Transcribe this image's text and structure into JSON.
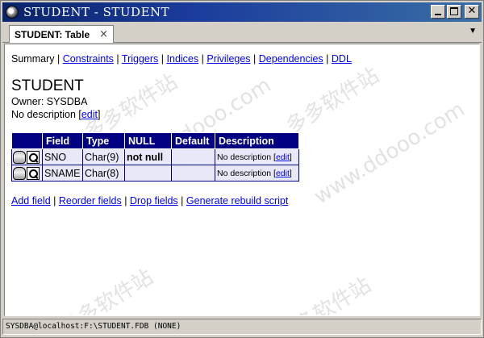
{
  "window": {
    "title": "STUDENT - STUDENT"
  },
  "tab": {
    "label": "STUDENT: Table",
    "close_glyph": "×",
    "menu_glyph": "▼"
  },
  "nav": {
    "summary": "Summary",
    "separator": "|",
    "links": [
      "Constraints",
      "Triggers",
      "Indices",
      "Privileges",
      "Dependencies",
      "DDL"
    ]
  },
  "table_info": {
    "name": "STUDENT",
    "owner": "Owner: SYSDBA",
    "description_prefix": "No description [",
    "edit_label": "edit",
    "description_suffix": "]"
  },
  "fields_table": {
    "headers": [
      "Field",
      "Type",
      "NULL",
      "Default",
      "Description"
    ],
    "rows": [
      {
        "field": "SNO",
        "type": "Char(9)",
        "null": "not null",
        "default": "",
        "description": "No description",
        "edit": "edit"
      },
      {
        "field": "SNAME",
        "type": "Char(8)",
        "null": "",
        "default": "",
        "description": "No description",
        "edit": "edit"
      }
    ]
  },
  "actions": [
    "Add field",
    "Reorder fields",
    "Drop fields",
    "Generate rebuild script"
  ],
  "status": {
    "text": "SYSDBA@localhost:F:\\STUDENT.FDB (NONE)"
  },
  "watermarks": [
    "多多软件站",
    "www.ddooo.com"
  ]
}
